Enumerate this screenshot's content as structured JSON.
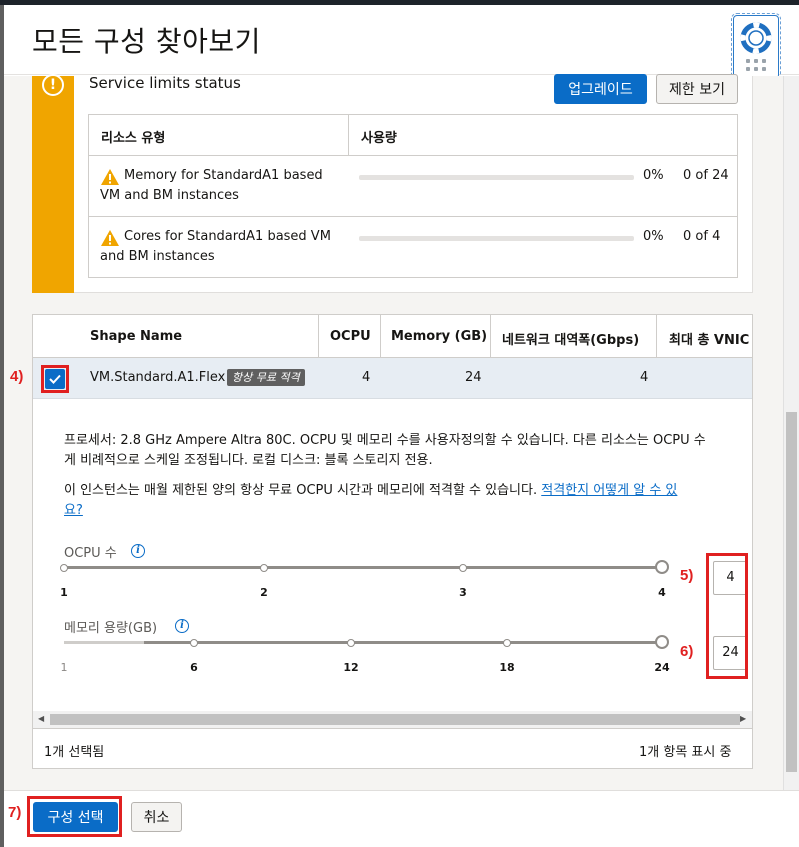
{
  "dialog": {
    "title": "모든 구성 찾아보기"
  },
  "limits": {
    "title": "Service limits status",
    "upgrade_label": "업그레이드",
    "view_label": "제한 보기",
    "columns": [
      "리소스 유형",
      "사용량"
    ],
    "rows": [
      {
        "resource": "Memory for StandardA1 based VM and BM instances",
        "percent": "0%",
        "count": "0 of 24",
        "usage_fraction": 0
      },
      {
        "resource": "Cores for StandardA1 based VM and BM instances",
        "percent": "0%",
        "count": "0 of 4",
        "usage_fraction": 0
      }
    ]
  },
  "shapes": {
    "columns": [
      "Shape Name",
      "OCPU",
      "Memory (GB)",
      "네트워크 대역폭(Gbps)",
      "최대 총 VNIC"
    ],
    "selected_row": {
      "name": "VM.Standard.A1.Flex",
      "badge": "항상 무료 적격",
      "ocpu": "4",
      "memory": "24",
      "bandwidth": "4",
      "checked": true
    },
    "details": {
      "line1": "프로세서: 2.8 GHz Ampere Altra 80C. OCPU 및 메모리 수를 사용자정의할 수 있습니다. 다른 리소스는 OCPU 수",
      "line2": "게 비례적으로 스케일 조정됩니다. 로컬 디스크: 블록 스토리지 전용.",
      "line3": "이 인스턴스는 매월 제한된 양의 항상 무료 OCPU 시간과 메모리에 적격할 수 있습니다.",
      "link_part1": "적격한지 어떻게 알 수 있",
      "link_part2": "요?"
    },
    "ocpu_slider": {
      "label": "OCPU 수",
      "ticks": [
        "1",
        "2",
        "3",
        "4"
      ],
      "value": "4"
    },
    "memory_slider": {
      "label": "메모리 용량(GB)",
      "ticks": [
        "1",
        "6",
        "12",
        "18",
        "24"
      ],
      "value": "24"
    },
    "footer": {
      "selected": "1개 선택됨",
      "showing": "1개 항목 표시 중"
    }
  },
  "actions": {
    "select_label": "구성 선택",
    "cancel_label": "취소"
  },
  "annotations": {
    "step4": "4)",
    "step5": "5)",
    "step6": "6)",
    "step7": "7)"
  },
  "colors": {
    "accent": "#0a6cc7",
    "warning": "#f0a500",
    "annotation": "#e02020"
  },
  "icons": [
    "help-lifebuoy-icon",
    "info-icon",
    "warning-triangle-icon",
    "checkmark-icon"
  ]
}
